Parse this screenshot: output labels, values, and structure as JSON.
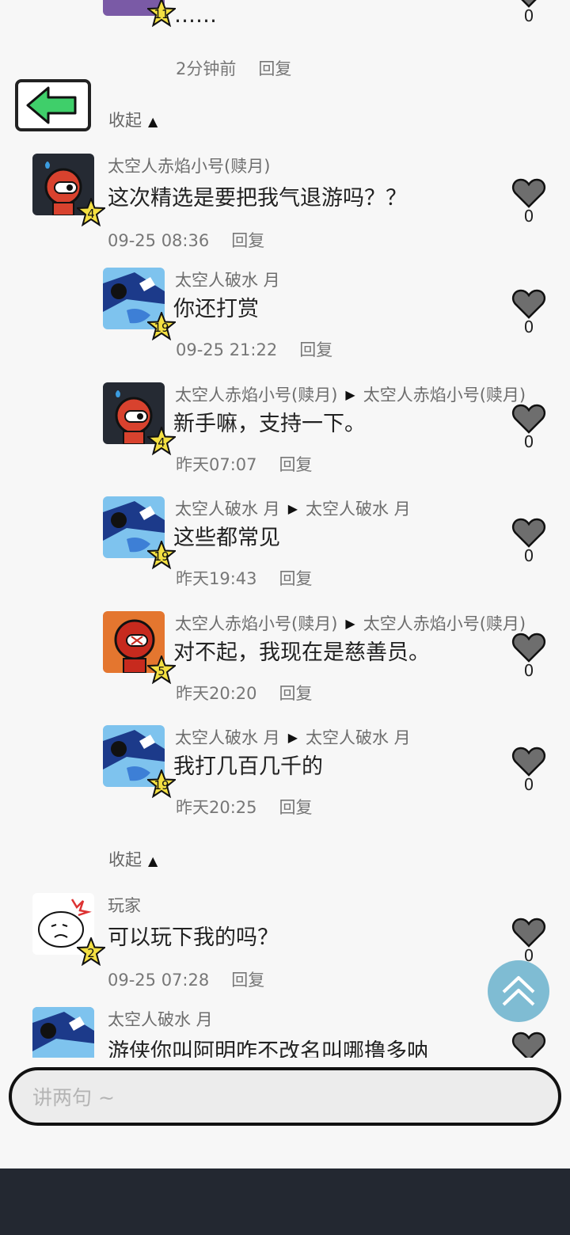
{
  "top_partial": {
    "text": "……",
    "level": "11",
    "time": "2分钟前",
    "reply_label": "回复",
    "likes": "0"
  },
  "back_button": {
    "icon": "left-arrow-icon"
  },
  "collapse_label": "收起",
  "comment": {
    "author": "太空人赤焰小号(赎月)",
    "text": "这次精选是要把我气退游吗？？",
    "time": "09-25 08:36",
    "reply_label": "回复",
    "likes": "0",
    "level": "4"
  },
  "replies": [
    {
      "author": "太空人破水 月",
      "target": "",
      "text": "你还打赏",
      "time": "09-25 21:22",
      "reply_label": "回复",
      "likes": "0",
      "level": "19",
      "avatar": "blue"
    },
    {
      "author": "太空人赤焰小号(赎月)",
      "target": "太空人赤焰小号(赎月)",
      "text": "新手嘛，支持一下。",
      "time": "昨天07:07",
      "reply_label": "回复",
      "likes": "0",
      "level": "4",
      "avatar": "red"
    },
    {
      "author": "太空人破水 月",
      "target": "太空人破水 月",
      "text": "这些都常见",
      "time": "昨天19:43",
      "reply_label": "回复",
      "likes": "0",
      "level": "19",
      "avatar": "blue"
    },
    {
      "author": "太空人赤焰小号(赎月)",
      "target": "太空人赤焰小号(赎月)",
      "text": "对不起，我现在是慈善员。",
      "time": "昨天20:20",
      "reply_label": "回复",
      "likes": "0",
      "level": "5",
      "avatar": "orange"
    },
    {
      "author": "太空人破水 月",
      "target": "太空人破水 月",
      "text": "我打几百几千的",
      "time": "昨天20:25",
      "reply_label": "回复",
      "likes": "0",
      "level": "19",
      "avatar": "blue"
    }
  ],
  "comment2": {
    "author": "玩家",
    "text": "可以玩下我的吗？",
    "time": "09-25 07:28",
    "reply_label": "回复",
    "likes": "0",
    "level": "2"
  },
  "comment3": {
    "author": "太空人破水 月",
    "text": "游侠你叫阿明咋不改名叫哪撸多呐"
  },
  "input": {
    "placeholder": "讲两句 ~"
  },
  "colors": {
    "accent_top_button": "#7fbcd3",
    "bottom_bar": "#232831",
    "back_arrow": "#3fcf6a",
    "star": "#f4e042"
  }
}
